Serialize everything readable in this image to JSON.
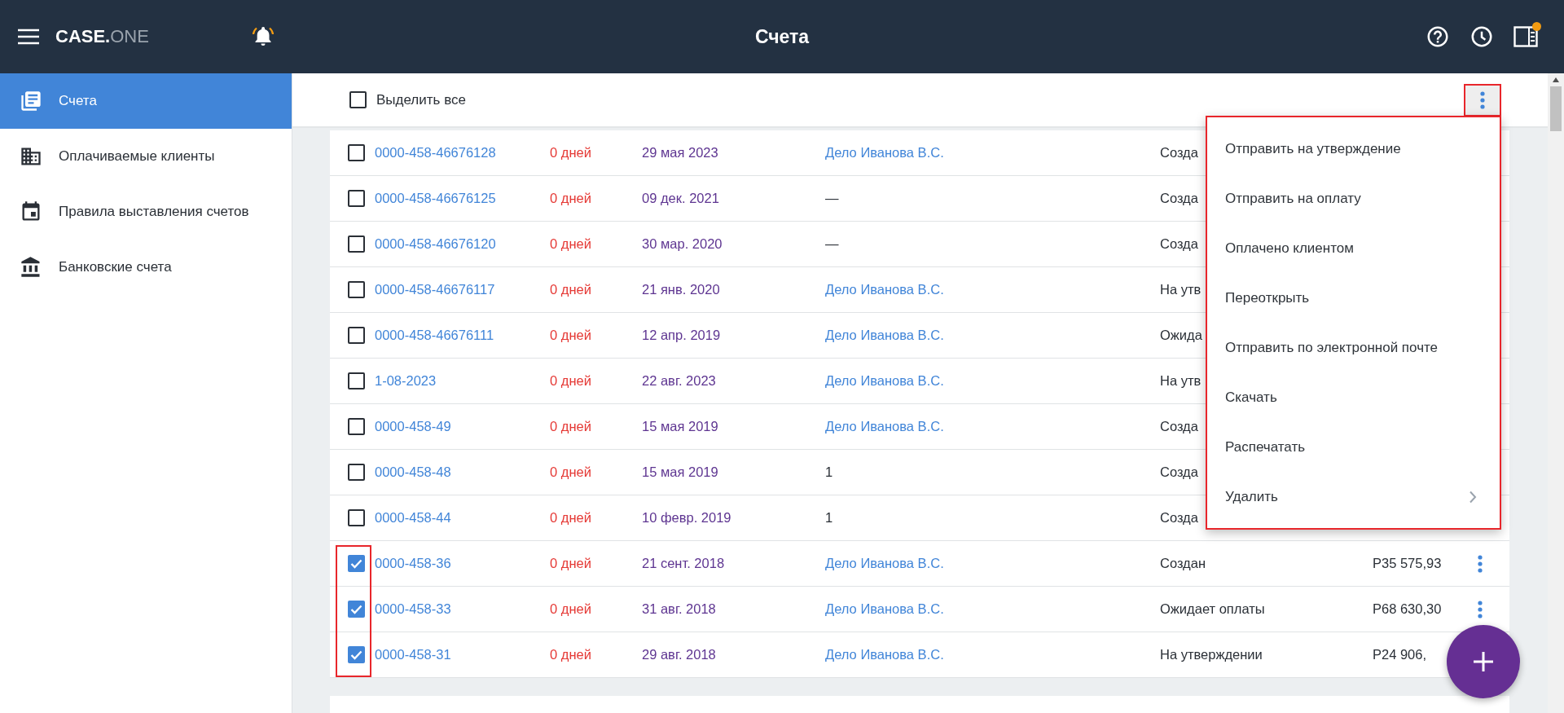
{
  "header": {
    "logo": {
      "primary": "CASE.",
      "secondary": "ONE"
    },
    "title": "Счета",
    "notification_dot": true
  },
  "sidebar": {
    "items": [
      {
        "label": "Счета",
        "selected": true
      },
      {
        "label": "Оплачиваемые клиенты",
        "selected": false
      },
      {
        "label": "Правила выставления счетов",
        "selected": false
      },
      {
        "label": "Банковские счета",
        "selected": false
      }
    ]
  },
  "toolbar": {
    "select_all": {
      "label": "Выделить все",
      "checked": false
    },
    "menu_open": true
  },
  "rows": [
    {
      "number": "0000-458-46676128",
      "days": "0 дней",
      "date": "29 мая 2023",
      "case": "Дело Иванова В.С.",
      "case_link": true,
      "status": "Созда",
      "checked": false
    },
    {
      "number": "0000-458-46676125",
      "days": "0 дней",
      "date": "09 дек. 2021",
      "case": "—",
      "case_link": false,
      "status": "Созда",
      "checked": false
    },
    {
      "number": "0000-458-46676120",
      "days": "0 дней",
      "date": "30 мар. 2020",
      "case": "—",
      "case_link": false,
      "status": "Созда",
      "checked": false
    },
    {
      "number": "0000-458-46676117",
      "days": "0 дней",
      "date": "21 янв. 2020",
      "case": "Дело Иванова В.С.",
      "case_link": true,
      "status": "На утв",
      "checked": false
    },
    {
      "number": "0000-458-46676111",
      "days": "0 дней",
      "date": "12 апр. 2019",
      "case": "Дело Иванова В.С.",
      "case_link": true,
      "status": "Ожида",
      "checked": false
    },
    {
      "number": "1-08-2023",
      "days": "0 дней",
      "date": "22 авг. 2023",
      "case": "Дело Иванова В.С.",
      "case_link": true,
      "status": "На утв",
      "checked": false
    },
    {
      "number": "0000-458-49",
      "days": "0 дней",
      "date": "15 мая 2019",
      "case": "Дело Иванова В.С.",
      "case_link": true,
      "status": "Созда",
      "checked": false
    },
    {
      "number": "0000-458-48",
      "days": "0 дней",
      "date": "15 мая 2019",
      "case": "1",
      "case_link": false,
      "status": "Созда",
      "checked": false
    },
    {
      "number": "0000-458-44",
      "days": "0 дней",
      "date": "10 февр. 2019",
      "case": "1",
      "case_link": false,
      "status": "Созда",
      "checked": false
    },
    {
      "number": "0000-458-36",
      "days": "0 дней",
      "date": "21 сент. 2018",
      "case": "Дело Иванова В.С.",
      "case_link": true,
      "status": "Создан",
      "amount": "Р35 575,93",
      "menu_button": true,
      "checked": true
    },
    {
      "number": "0000-458-33",
      "days": "0 дней",
      "date": "31 авг. 2018",
      "case": "Дело Иванова В.С.",
      "case_link": true,
      "status": "Ожидает оплаты",
      "amount": "Р68 630,30",
      "menu_button": true,
      "checked": true
    },
    {
      "number": "0000-458-31",
      "days": "0 дней",
      "date": "29 авг. 2018",
      "case": "Дело Иванова В.С.",
      "case_link": true,
      "status": "На утверждении",
      "amount": "Р24 906,",
      "checked": true
    }
  ],
  "menu": {
    "items": [
      {
        "label": "Отправить на утверждение",
        "submenu": false
      },
      {
        "label": "Отправить на оплату",
        "submenu": false
      },
      {
        "label": "Оплачено клиентом",
        "submenu": false
      },
      {
        "label": "Переоткрыть",
        "submenu": false
      },
      {
        "label": "Отправить по электронной почте",
        "submenu": false
      },
      {
        "label": "Скачать",
        "submenu": false
      },
      {
        "label": "Распечатать",
        "submenu": false
      },
      {
        "label": "Удалить",
        "submenu": true
      }
    ]
  }
}
